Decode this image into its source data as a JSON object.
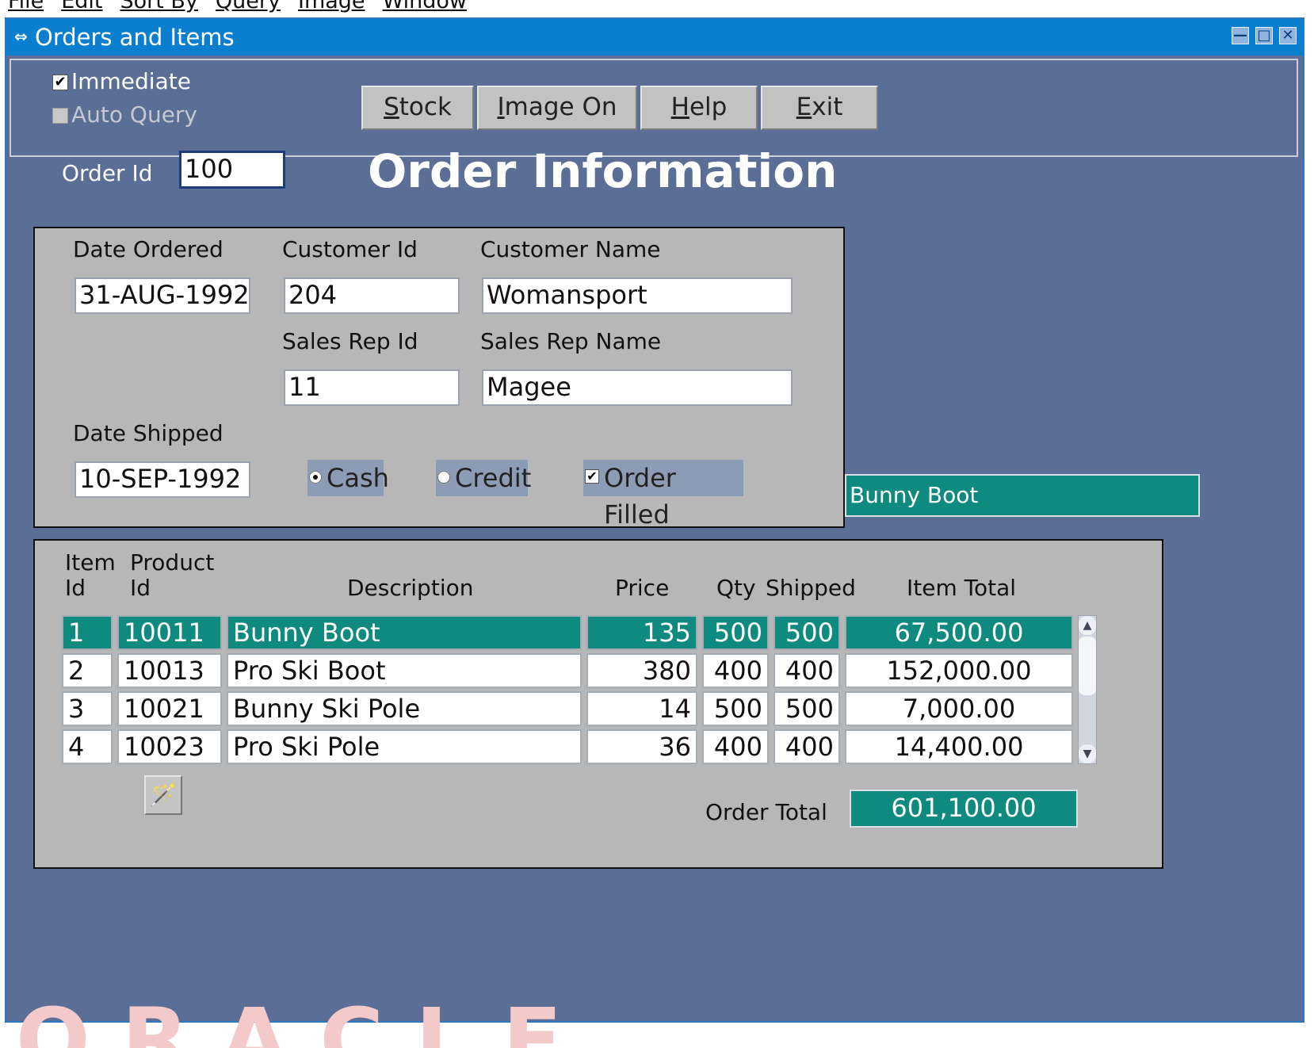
{
  "menubar": [
    "File",
    "Edit",
    "Sort By",
    "Query",
    "Image",
    "Window"
  ],
  "watermark": "ORACLE TUTORIALS",
  "window": {
    "title": "Orders and Items",
    "controls": {
      "minimize": "—",
      "maximize": "□",
      "close": "✕"
    }
  },
  "toolbar": {
    "immediate": {
      "label": "Immediate",
      "checked": true
    },
    "auto_query": {
      "label": "Auto Query",
      "checked": false,
      "disabled": true
    },
    "buttons": [
      {
        "first": "S",
        "rest": "tock"
      },
      {
        "first": "I",
        "rest": "mage On"
      },
      {
        "first": "H",
        "rest": "elp"
      },
      {
        "first": "E",
        "rest": "xit"
      }
    ]
  },
  "order": {
    "order_id_label": "Order Id",
    "order_id": "100",
    "heading": "Order Information"
  },
  "info": {
    "date_ordered_label": "Date Ordered",
    "date_ordered": "31-AUG-1992",
    "customer_id_label": "Customer Id",
    "customer_id": "204",
    "customer_name_label": "Customer Name",
    "customer_name": "Womansport",
    "sales_rep_id_label": "Sales Rep Id",
    "sales_rep_id": "11",
    "sales_rep_name_label": "Sales Rep Name",
    "sales_rep_name": "Magee",
    "date_shipped_label": "Date Shipped",
    "date_shipped": "10-SEP-1992",
    "payment": {
      "cash": "Cash",
      "credit": "Credit",
      "selected": "Cash"
    },
    "order_filled": {
      "label": "Order Filled",
      "checked": true
    }
  },
  "selected_product": "Bunny Boot",
  "items": {
    "headers": {
      "item_id_1": "Item",
      "item_id_2": "Id",
      "product_id_1": "Product",
      "product_id_2": "Id",
      "description": "Description",
      "price": "Price",
      "qty": "Qty",
      "shipped": "Shipped",
      "item_total": "Item Total"
    },
    "rows": [
      {
        "item": "1",
        "product": "10011",
        "desc": "Bunny Boot",
        "price": "135",
        "qty": "500",
        "shipped": "500",
        "total": "67,500.00"
      },
      {
        "item": "2",
        "product": "10013",
        "desc": "Pro Ski Boot",
        "price": "380",
        "qty": "400",
        "shipped": "400",
        "total": "152,000.00"
      },
      {
        "item": "3",
        "product": "10021",
        "desc": "Bunny Ski Pole",
        "price": "14",
        "qty": "500",
        "shipped": "500",
        "total": "7,000.00"
      },
      {
        "item": "4",
        "product": "10023",
        "desc": "Pro Ski Pole",
        "price": "36",
        "qty": "400",
        "shipped": "400",
        "total": "14,400.00"
      }
    ],
    "order_total_label": "Order Total",
    "order_total": "601,100.00",
    "icons": {
      "scroll_up": "▲",
      "scroll_down": "▼",
      "wand": "🪄"
    }
  },
  "colors": {
    "window_bg": "#5a6e96",
    "titlebar": "#0b7fcf",
    "panel": "#b7b7b7",
    "selected": "#0f8a7e"
  }
}
